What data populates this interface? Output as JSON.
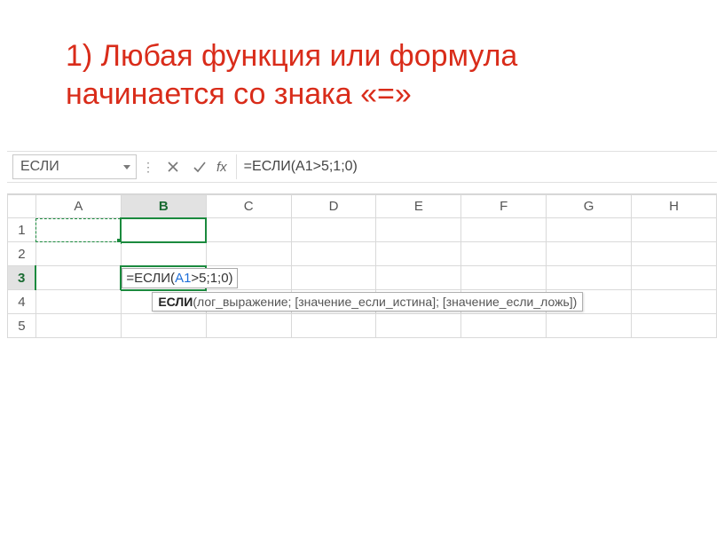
{
  "title": "1) Любая функция или формула начинается со знака «=»",
  "formulaBar": {
    "nameBox": "ЕСЛИ",
    "fxLabel": "fx",
    "formula": "=ЕСЛИ(A1>5;1;0)"
  },
  "columns": [
    "A",
    "B",
    "C",
    "D",
    "E",
    "F",
    "G",
    "H"
  ],
  "rows": [
    "1",
    "2",
    "3",
    "4",
    "5"
  ],
  "activeCol": "B",
  "activeRow": "3",
  "editingCell": {
    "prefix": "=ЕСЛИ(",
    "ref": "A1",
    "suffix": ">5;1;0)"
  },
  "tooltip": {
    "bold": "ЕСЛИ",
    "rest": "(лог_выражение; [значение_если_истина]; [значение_если_ложь])"
  }
}
